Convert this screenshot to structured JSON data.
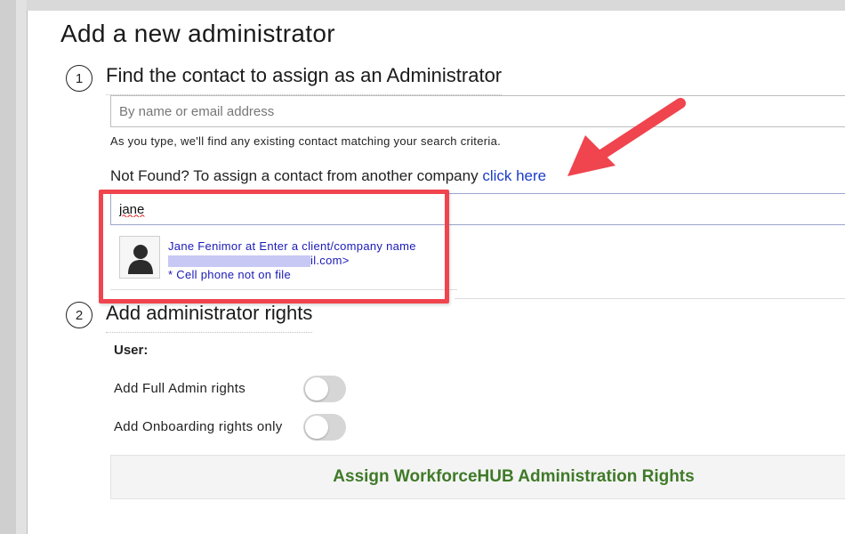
{
  "page": {
    "title": "Add a new administrator"
  },
  "step1": {
    "number": "1",
    "title": "Find the contact to assign as an Administrator",
    "search_placeholder": "By name or email address",
    "hint": "As you type, we'll find any existing contact matching your search criteria.",
    "not_found_text": "Not Found? To assign a contact from another company ",
    "not_found_link": "click here",
    "query_value": "jane",
    "suggestion": {
      "line1": "Jane Fenimor at Enter a client/company name",
      "email_suffix": "il.com>",
      "line3": "* Cell phone not on file"
    }
  },
  "step2": {
    "number": "2",
    "title": "Add administrator rights",
    "user_label": "User:",
    "full_admin_label": "Add Full Admin rights",
    "onboarding_label": "Add Onboarding rights only",
    "full_admin_on": false,
    "onboarding_on": false
  },
  "assign_button": "Assign WorkforceHUB Administration Rights",
  "colors": {
    "annotation_red": "#f0444e",
    "link_blue": "#1a3cc8",
    "assign_green": "#3f7a28"
  }
}
